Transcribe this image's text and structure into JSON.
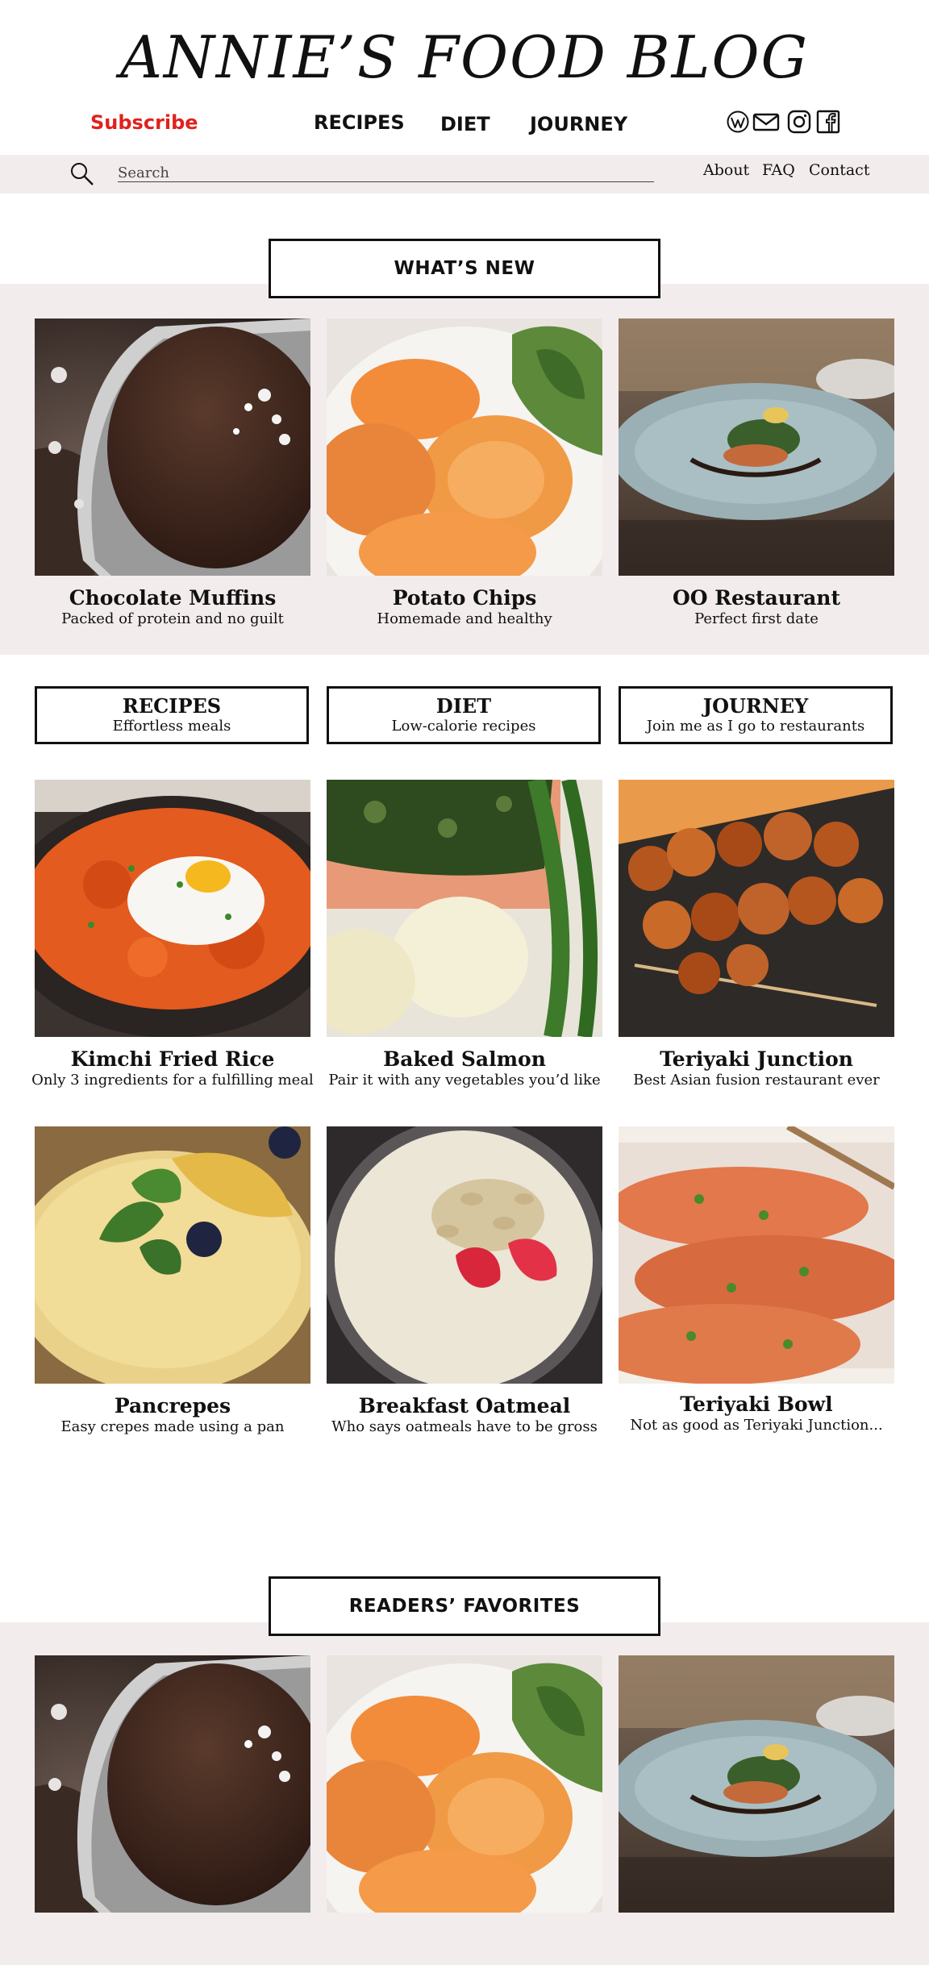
{
  "header": {
    "title": "ANNIE’S FOOD BLOG",
    "subscribe_label": "Subscribe",
    "nav": [
      "RECIPES",
      "DIET",
      "JOURNEY"
    ],
    "social_icons": [
      "wordpress-icon",
      "mail-icon",
      "instagram-icon",
      "facebook-icon"
    ]
  },
  "search": {
    "placeholder": "Search",
    "value": ""
  },
  "top_links": [
    "About",
    "FAQ",
    "Contact"
  ],
  "colors": {
    "accent": "#e0211d",
    "band": "#f3eced",
    "text": "#111111"
  },
  "whats_new": {
    "title": "WHAT’S NEW",
    "cards": [
      {
        "title": "Chocolate Muffins",
        "subtitle": "Packed of protein and no guilt"
      },
      {
        "title": "Potato Chips",
        "subtitle": "Homemade and healthy"
      },
      {
        "title": "OO Restaurant",
        "subtitle": "Perfect first date"
      }
    ]
  },
  "categories": [
    {
      "title": "RECIPES",
      "subtitle": "Effortless meals"
    },
    {
      "title": "DIET",
      "subtitle": "Low-calorie recipes"
    },
    {
      "title": "JOURNEY",
      "subtitle": "Join me as I go to restaurants"
    }
  ],
  "grid": [
    {
      "title": "Kimchi Fried Rice",
      "subtitle": "Only 3 ingredients for a fulfilling meal"
    },
    {
      "title": "Baked Salmon",
      "subtitle": "Pair it with any vegetables you’d like"
    },
    {
      "title": "Teriyaki Junction",
      "subtitle": "Best Asian fusion restaurant ever"
    },
    {
      "title": "Pancrepes",
      "subtitle": "Easy crepes made using a pan"
    },
    {
      "title": "Breakfast Oatmeal",
      "subtitle": "Who says oatmeals have to be gross"
    },
    {
      "title": "Teriyaki Bowl",
      "subtitle": "Not as good as Teriyaki Junction..."
    }
  ],
  "readers_favorites": {
    "title": "READERS’ FAVORITES"
  }
}
